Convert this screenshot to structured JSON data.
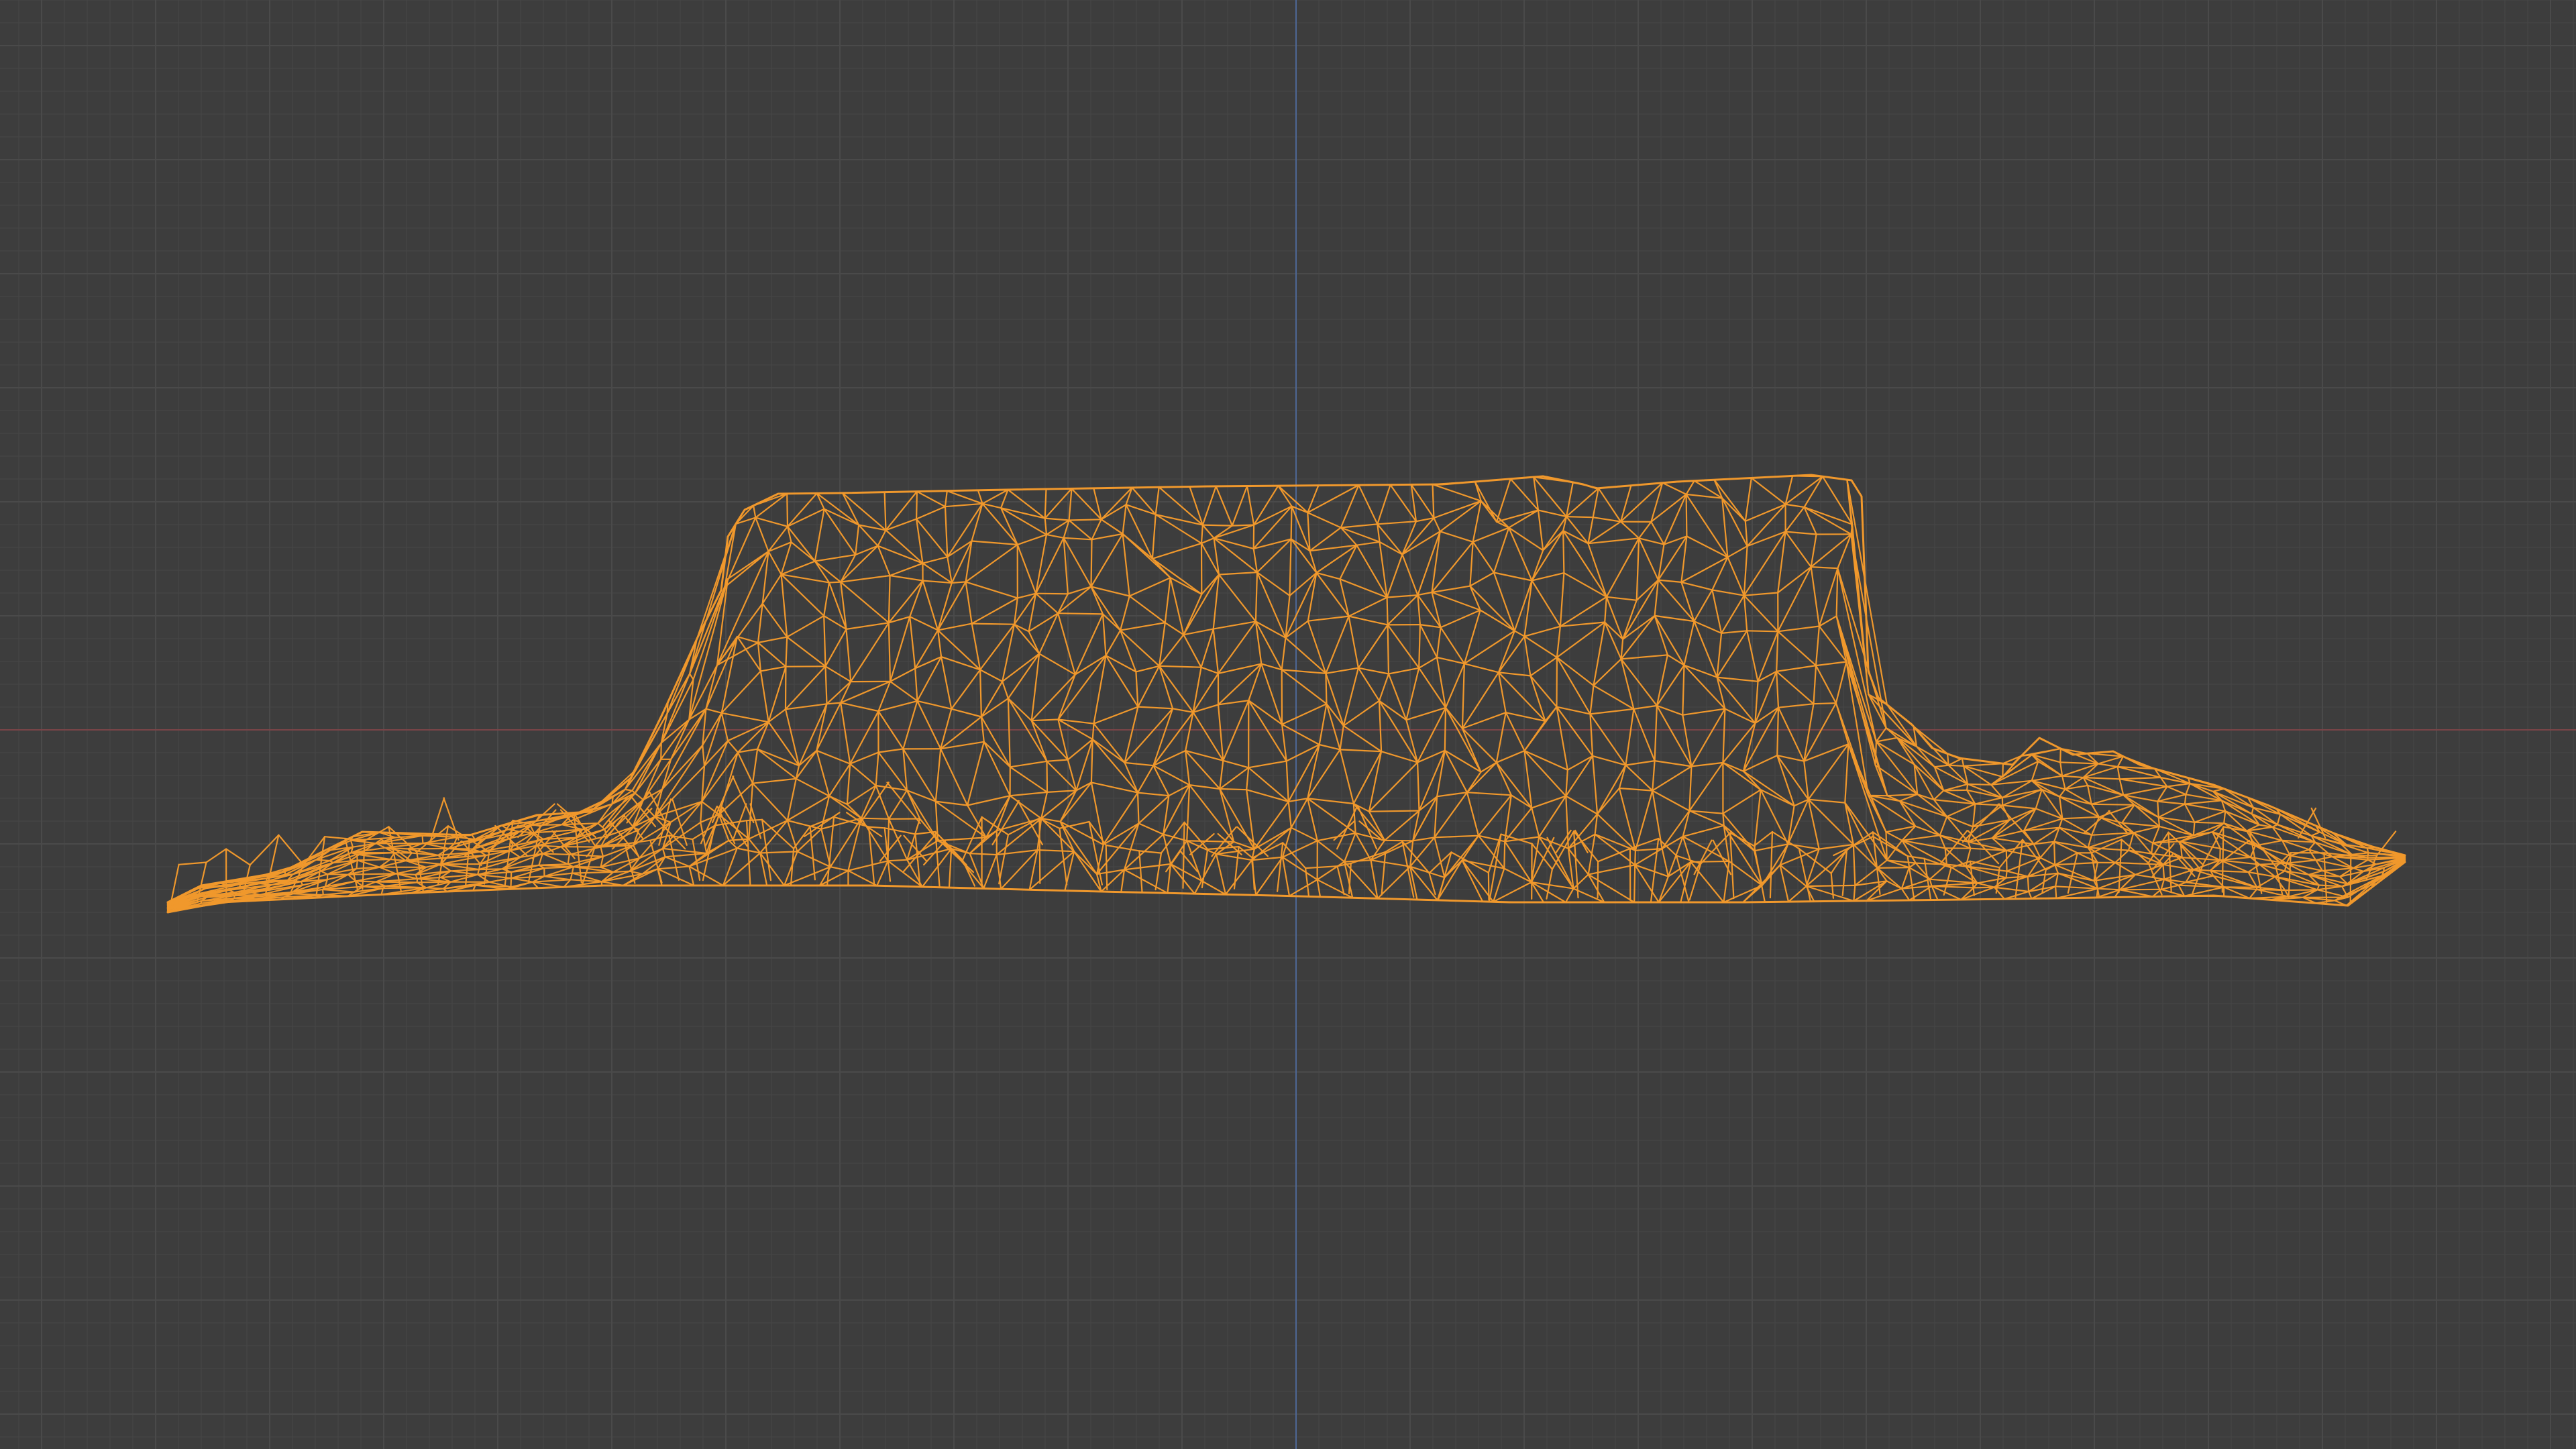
{
  "viewport": {
    "background_color": "#3d3d3d",
    "grid": {
      "enabled": true,
      "minor_line_color": "#454545",
      "major_line_color": "#4a4a4a"
    },
    "axes": {
      "x_axis_color": "#7a4448",
      "z_axis_color": "#4d6694"
    },
    "object": {
      "name": "",
      "display": "wireframe",
      "selected": true,
      "wire_color": "#f0982c",
      "shape": "flat-topped mesa with low terrain skirt"
    }
  }
}
